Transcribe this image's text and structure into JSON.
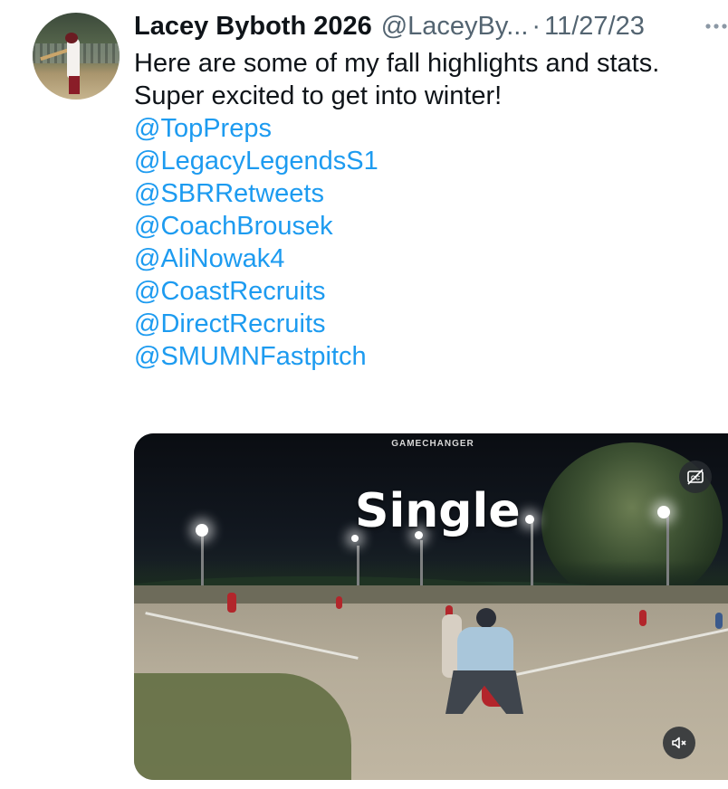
{
  "tweet": {
    "author_name": "Lacey Byboth 2026",
    "handle": "@LaceyBy...",
    "separator": "·",
    "date": "11/27/23",
    "text_lines": [
      "Here are some of my fall highlights and stats.",
      "Super excited to get into winter!"
    ],
    "mentions": [
      "@TopPreps",
      "@LegacyLegendsS1",
      "@SBRRetweets",
      "@CoachBrousek",
      "@AliNowak4",
      "@CoastRecruits",
      "@DirectRecruits",
      "@SMUMNFastpitch"
    ],
    "more_icon": "more-dots-icon"
  },
  "media": {
    "watermark": "GAMECHANGER",
    "overlay_text": "Single",
    "captions_icon": "captions-off-icon",
    "mute_icon": "volume-muted-icon"
  },
  "colors": {
    "text": "#0f1419",
    "secondary": "#536471",
    "link": "#1d9bf0"
  }
}
